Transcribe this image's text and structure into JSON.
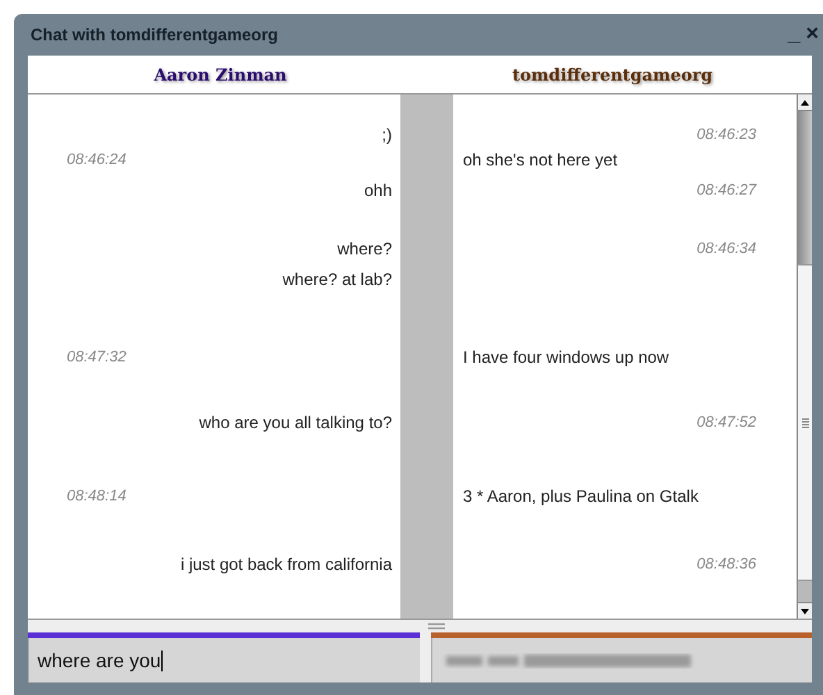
{
  "window": {
    "title": "Chat with tomdifferentgameorg",
    "controls": [
      "_",
      "×"
    ]
  },
  "participants": [
    {
      "name": "Aaron Zinman",
      "color": "#2b0d6e"
    },
    {
      "name": "tomdifferentgameorg",
      "color": "#5c2e0a"
    }
  ],
  "rows": [
    {
      "left": {
        "kind": "message",
        "text": ";)"
      },
      "right": {
        "kind": "time",
        "text": "08:46:23"
      }
    },
    {
      "left": {
        "kind": "time",
        "text": "08:46:24"
      },
      "right": {
        "kind": "message",
        "text": "oh she's not here yet"
      }
    },
    {
      "left": {
        "kind": "message",
        "text": "ohh"
      },
      "right": {
        "kind": "time",
        "text": "08:46:27"
      }
    },
    {
      "left": {
        "kind": "message",
        "text": "where?"
      },
      "right": {
        "kind": "time",
        "text": "08:46:34"
      }
    },
    {
      "left": {
        "kind": "message",
        "text": "where? at lab?"
      }
    },
    {
      "left": {
        "kind": "time",
        "text": "08:47:32"
      },
      "right": {
        "kind": "message",
        "text": "I have four windows up now"
      }
    },
    {
      "left": {
        "kind": "message",
        "text": "who are you all talking to?"
      },
      "right": {
        "kind": "time",
        "text": "08:47:52"
      }
    },
    {
      "left": {
        "kind": "time",
        "text": "08:48:14"
      },
      "right": {
        "kind": "message",
        "text": "3 * Aaron, plus Paulina on Gtalk"
      }
    },
    {
      "left": {
        "kind": "message",
        "text": "i just got back from california"
      },
      "right": {
        "kind": "time",
        "text": "08:48:36"
      }
    }
  ],
  "inputs": [
    {
      "value": "where are you",
      "color": "#5b2fd6"
    },
    {
      "kind": "blurred",
      "color": "#b8612a"
    }
  ]
}
